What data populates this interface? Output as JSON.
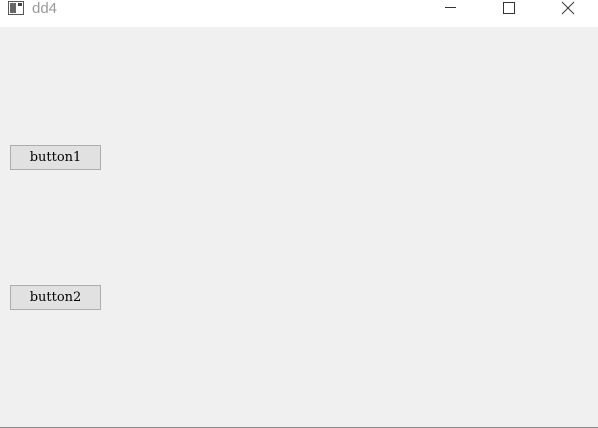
{
  "window": {
    "title": "dd4",
    "controls": [
      "minimize-icon",
      "maximize-icon",
      "close-icon"
    ]
  },
  "buttons": [
    {
      "label": "button1"
    },
    {
      "label": "button2"
    }
  ],
  "colors": {
    "client_background": "#f0f0f0",
    "titlebar_background": "#ffffff",
    "title_text": "#9a9a9a",
    "button_face": "#e1e1e1",
    "button_border": "#adadad"
  }
}
